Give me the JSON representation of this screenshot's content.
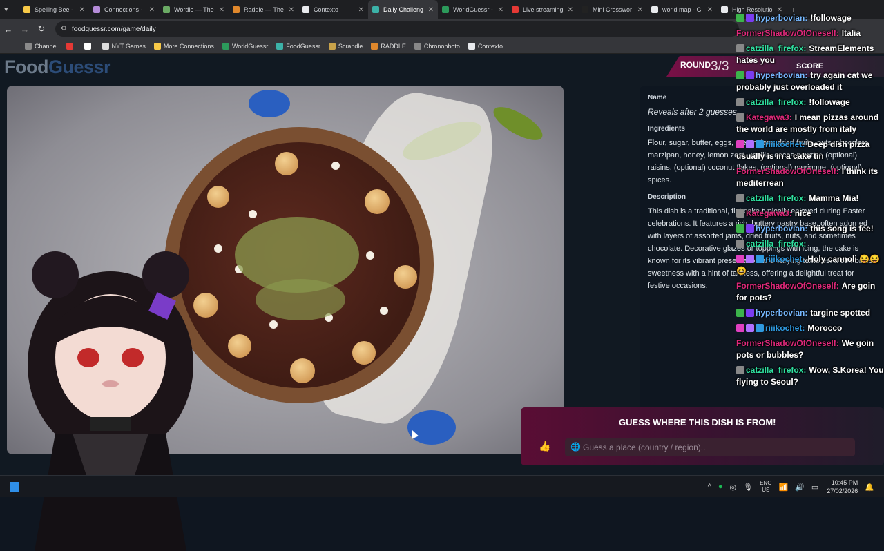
{
  "browser": {
    "tabs": [
      {
        "label": "Spelling Bee -",
        "color": "#f7c948"
      },
      {
        "label": "Connections -",
        "color": "#b58cd9"
      },
      {
        "label": "Wordle — The",
        "color": "#6aaa64"
      },
      {
        "label": "Raddle — The",
        "color": "#e0882c"
      },
      {
        "label": "Contexto",
        "color": "#e8eaed"
      },
      {
        "label": "Daily Challeng",
        "color": "#3cb2a8",
        "active": true
      },
      {
        "label": "WorldGuessr -",
        "color": "#2c9a5b"
      },
      {
        "label": "Live streaming",
        "color": "#e53935"
      },
      {
        "label": "Mini Crosswor",
        "color": "#222222"
      },
      {
        "label": "world map - G",
        "color": "#e8eaed"
      },
      {
        "label": "High Resolutio",
        "color": "#e8eaed"
      }
    ],
    "url": "foodguessr.com/game/daily",
    "bookmarks": [
      {
        "label": "Channel",
        "color": "#8a8a8a"
      },
      {
        "label": "",
        "color": "#e53935"
      },
      {
        "label": "",
        "color": "#ffffff"
      },
      {
        "label": "NYT Games",
        "color": "#dddddd"
      },
      {
        "label": "More Connections",
        "color": "#f7c948"
      },
      {
        "label": "WorldGuessr",
        "color": "#2c9a5b"
      },
      {
        "label": "FoodGuessr",
        "color": "#3cb2a8"
      },
      {
        "label": "Scrandle",
        "color": "#c8a24a"
      },
      {
        "label": "RADDLE",
        "color": "#e0882c"
      },
      {
        "label": "Chronophoto",
        "color": "#888888"
      },
      {
        "label": "Contexto",
        "color": "#e8eaed"
      }
    ]
  },
  "game": {
    "logo_a": "Food",
    "logo_b": "Guessr",
    "round_label": "ROUND",
    "round_value": "3/3",
    "score_label": "SCORE",
    "name_heading": "Name",
    "name_value": "Reveals after 2 guesses",
    "ingredients_heading": "Ingredients",
    "ingredients_value": "Flour, sugar, butter, eggs, cream, jam, dried fruits, nuts, chocolate, marzipan, honey, lemon zest, vanilla, cocoa powder, (optional) raisins, (optional) coconut flakes, (optional) meringue, (optional) spices.",
    "description_heading": "Description",
    "description_value": "This dish is a traditional, flat cake typically enjoyed during Easter celebrations. It features a rich, buttery pastry base, often adorned with layers of assorted jams, dried fruits, nuts, and sometimes chocolate. Decorative glazes or toppings with icing, the cake is known for its vibrant presentation and varying textures. It combines sweetness with a hint of tartness, offering a delightful treat for festive occasions.",
    "guess_heading": "GUESS WHERE THIS DISH IS FROM!",
    "guess_placeholder": "Guess a place (country / region).."
  },
  "chat": [
    {
      "user": "hyperbovian:",
      "color": "#76b8ff",
      "text": "!followage",
      "badges": [
        "#3cb44b",
        "#7a3cf0"
      ]
    },
    {
      "user": "FormerShadowOfOneself:",
      "color": "#e0287a",
      "text": "Italia",
      "badges": []
    },
    {
      "user": "catzilla_firefox:",
      "color": "#2fe0a0",
      "text": "StreamElements hates you",
      "badges": [
        "#888888"
      ]
    },
    {
      "user": "hyperbovian:",
      "color": "#76b8ff",
      "text": "try again cat we probably just overloaded it",
      "badges": [
        "#3cb44b",
        "#7a3cf0"
      ]
    },
    {
      "user": "catzilla_firefox:",
      "color": "#2fe0a0",
      "text": "!followage",
      "badges": [
        "#888888"
      ]
    },
    {
      "user": "Kategawa3:",
      "color": "#e0287a",
      "text": "I mean pizzas around the world are mostly from italy",
      "badges": [
        "#888888"
      ]
    },
    {
      "user": "riiikochet:",
      "color": "#2f9ae0",
      "text": "Deep dish pizza usually is in a cake tin",
      "badges": [
        "#e040c0",
        "#b070ff",
        "#2f9ae0"
      ]
    },
    {
      "user": "FormerShadowOfOneself:",
      "color": "#e0287a",
      "text": "I think its mediterrean",
      "badges": []
    },
    {
      "user": "catzilla_firefox:",
      "color": "#2fe0a0",
      "text": "Mamma Mia!",
      "badges": [
        "#888888"
      ]
    },
    {
      "user": "Kategawa3:",
      "color": "#e0287a",
      "text": "nice",
      "badges": [
        "#888888"
      ]
    },
    {
      "user": "hyperbovian:",
      "color": "#76b8ff",
      "text": "this song is fee!",
      "badges": [
        "#3cb44b",
        "#7a3cf0"
      ]
    },
    {
      "user": "catzilla_firefox:",
      "color": "#2fe0a0",
      "text": "",
      "badges": [
        "#888888"
      ]
    },
    {
      "user": "riiikochet:",
      "color": "#2f9ae0",
      "text": "Holy cannoli 😆😆😆",
      "badges": [
        "#e040c0",
        "#b070ff",
        "#2f9ae0"
      ]
    },
    {
      "user": "FormerShadowOfOneself:",
      "color": "#e0287a",
      "text": "Are goin for pots?",
      "badges": []
    },
    {
      "user": "hyperbovian:",
      "color": "#76b8ff",
      "text": "targine spotted",
      "badges": [
        "#3cb44b",
        "#7a3cf0"
      ]
    },
    {
      "user": "riiikochet:",
      "color": "#2f9ae0",
      "text": "Morocco",
      "badges": [
        "#e040c0",
        "#b070ff",
        "#2f9ae0"
      ]
    },
    {
      "user": "FormerShadowOfOneself:",
      "color": "#e0287a",
      "text": "We goin pots or bubbles?",
      "badges": []
    },
    {
      "user": "catzilla_firefox:",
      "color": "#2fe0a0",
      "text": "Wow, S.Korea! You flying to Seoul?",
      "badges": [
        "#888888"
      ]
    }
  ],
  "taskbar": {
    "lang_top": "ENG",
    "lang_bottom": "US",
    "time": "10:45 PM",
    "date": "27/02/2026"
  }
}
